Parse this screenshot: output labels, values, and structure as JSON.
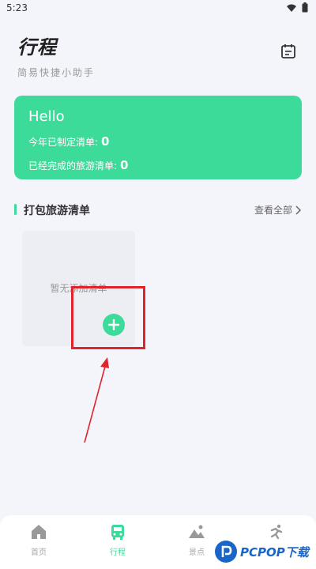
{
  "status_bar": {
    "time": "5:23"
  },
  "header": {
    "title": "行程",
    "subtitle": "简易快捷小助手"
  },
  "icons": {
    "calendar": "calendar-icon",
    "wifi": "wifi-icon",
    "battery": "battery-icon"
  },
  "card": {
    "greeting": "Hello",
    "planned_label": "今年已制定清单:",
    "planned_count": "0",
    "completed_label": "已经完成的旅游清单:",
    "completed_count": "0"
  },
  "section": {
    "title": "打包旅游清单",
    "view_all": "查看全部"
  },
  "empty": {
    "text": "暂无添加清单"
  },
  "nav": {
    "items": [
      {
        "label": "首页",
        "icon": "home-icon"
      },
      {
        "label": "行程",
        "icon": "bus-icon"
      },
      {
        "label": "景点",
        "icon": "mountain-icon"
      },
      {
        "label": "",
        "icon": "runner-icon"
      }
    ],
    "active_index": 1
  },
  "watermark": {
    "text": "PCPOP下载"
  },
  "colors": {
    "accent": "#3ddb9a",
    "highlight": "#e0242b",
    "watermark": "#1a66c8"
  }
}
